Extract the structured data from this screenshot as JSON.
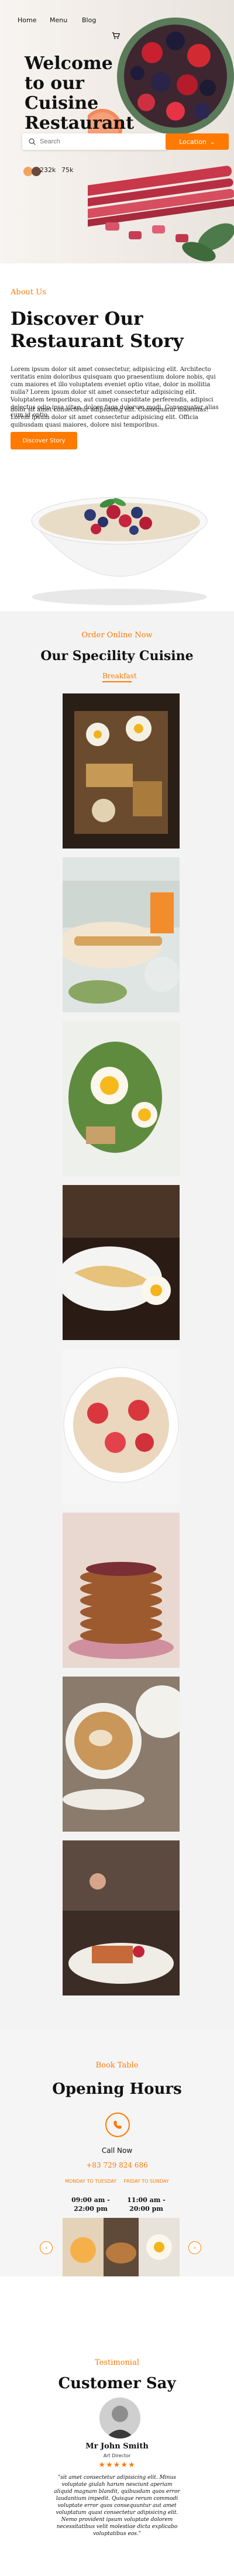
{
  "nav": {
    "items": [
      "Home",
      "Menu",
      "Blog"
    ]
  },
  "hero": {
    "title_line1": "Welcome",
    "title_line2": "to our Cuisine",
    "title_line3": "Restaurant",
    "search_placeholder": "Search",
    "location_button": "Location",
    "stat1": "232k",
    "stat2": "75k"
  },
  "about": {
    "label": "About Us",
    "title": "Discover Our Restaurant Story",
    "para1": "Lorem ipsum dolor sit amet consectetur, adipisicing elit. Architecto veritatis enim doloribus quisquam quo praesentium dolore nobis, qui cum maiores et illo voluptatem eveniet optio vitae, dolor in mollitia nulla? Lorem ipsum dolor sit amet consectetur adipisicing elit. Voluptatem temporibus, aut cumque cupiditate perferendis, adipisci delectus odio ipsa vitae, dolore fuga dolorum modi. Consequatur alias cum id optio.",
    "para2": "dolor sit amet consectetur adipisicing elit. Consequatur molestias! Lorem ipsum dolor sit amet consectetur adipisicing elit. Officia quibusdam quasi maiores, dolore nisi temporibus.",
    "button": "Discover Story"
  },
  "specialty": {
    "label": "Order Online Now",
    "title": "Our Specility Cuisine",
    "tab": "Breakfast"
  },
  "hours": {
    "label": "Book Table",
    "title": "Opening Hours",
    "call_now": "Call Now",
    "phone": "+83 729 824 686",
    "days1": "MONDAY TO TUESDAY",
    "time1": "09:00 am - 22:00 pm",
    "days2": "FRIDAY TO SUNDAY",
    "time2": "11:00 am - 20:00 pm"
  },
  "testimonial": {
    "label": "Testimonial",
    "title": "Customer Say",
    "name": "Mr John Smith",
    "role": "Art Director",
    "stars": "★★★★★",
    "quote": "\"sit amet consectetur adipisicing elit. Minus voluptate giulah harum nesciunt aperiam aliquid magnam blandit, quibusdam quos error laudantium impedit. Quisque rerum commodi voluptate error quos consequuntur aut amet voluptatum quasi consectetur adipisicing elit. Nemo provident ipsum voluptate dolorem necessitatibus velit molestiae dicta explicabo voluptatibus eos.\""
  },
  "colors": {
    "accent": "#ff7a00"
  }
}
